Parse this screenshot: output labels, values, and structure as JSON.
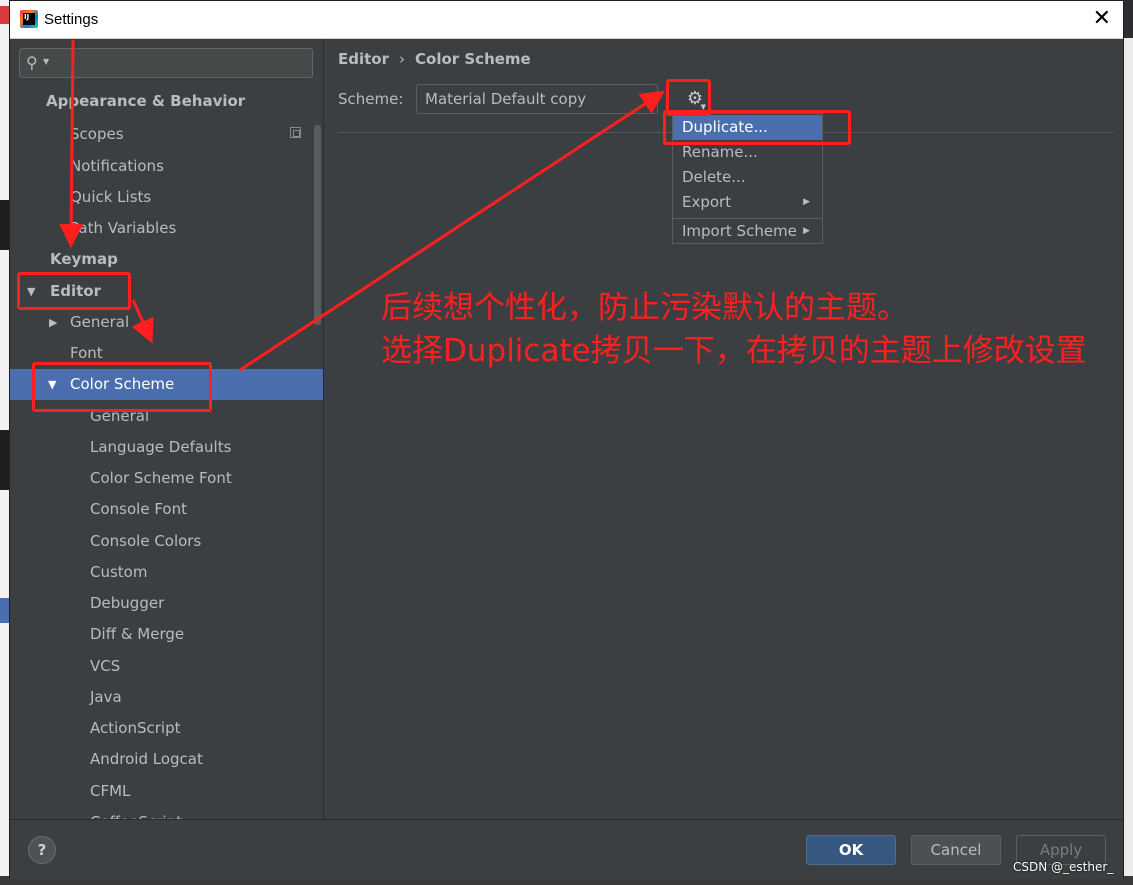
{
  "window": {
    "title": "Settings",
    "close_glyph": "✕"
  },
  "search": {
    "icon": "search-icon",
    "value": ""
  },
  "sidebar": {
    "items": [
      {
        "label": "Appearance & Behavior",
        "level": 0,
        "bold": true
      },
      {
        "label": "Scopes",
        "level": 1
      },
      {
        "label": "Notifications",
        "level": 1
      },
      {
        "label": "Quick Lists",
        "level": 1
      },
      {
        "label": "Path Variables",
        "level": 1
      },
      {
        "label": "Keymap",
        "level": 0,
        "bold": true
      },
      {
        "label": "Editor",
        "level": 0,
        "bold": true,
        "expanded": true
      },
      {
        "label": "General",
        "level": 1,
        "collapsed": true
      },
      {
        "label": "Font",
        "level": 1
      },
      {
        "label": "Color Scheme",
        "level": 1,
        "expanded": true,
        "selected": true
      },
      {
        "label": "General",
        "level": 2
      },
      {
        "label": "Language Defaults",
        "level": 2
      },
      {
        "label": "Color Scheme Font",
        "level": 2
      },
      {
        "label": "Console Font",
        "level": 2
      },
      {
        "label": "Console Colors",
        "level": 2
      },
      {
        "label": "Custom",
        "level": 2
      },
      {
        "label": "Debugger",
        "level": 2
      },
      {
        "label": "Diff & Merge",
        "level": 2
      },
      {
        "label": "VCS",
        "level": 2
      },
      {
        "label": "Java",
        "level": 2
      },
      {
        "label": "ActionScript",
        "level": 2
      },
      {
        "label": "Android Logcat",
        "level": 2
      },
      {
        "label": "CFML",
        "level": 2
      },
      {
        "label": "CoffeeScript",
        "level": 2
      }
    ]
  },
  "main": {
    "breadcrumb": {
      "parent": "Editor",
      "separator": "›",
      "current": "Color Scheme"
    },
    "scheme_label": "Scheme:",
    "scheme_value": "Material Default copy",
    "gear_icon": "gear-icon"
  },
  "popup_menu": {
    "items": [
      {
        "label": "Duplicate...",
        "selected": true
      },
      {
        "label": "Rename..."
      },
      {
        "label": "Delete..."
      },
      {
        "label": "Export",
        "submenu": true
      },
      {
        "label": "Import Scheme",
        "submenu": true
      }
    ]
  },
  "footer": {
    "help": "?",
    "ok": "OK",
    "cancel": "Cancel",
    "apply": "Apply"
  },
  "annotation": {
    "line1": "后续想个性化，防止污染默认的主题。",
    "line2": "选择Duplicate拷贝一下，在拷贝的主题上修改设置",
    "color": "#ff1f1f"
  },
  "watermark": "CSDN @_esther_",
  "colors": {
    "background": "#3c3f41",
    "selection": "#4b6eaf",
    "text": "#bbbbbb",
    "ok_button": "#365880"
  }
}
